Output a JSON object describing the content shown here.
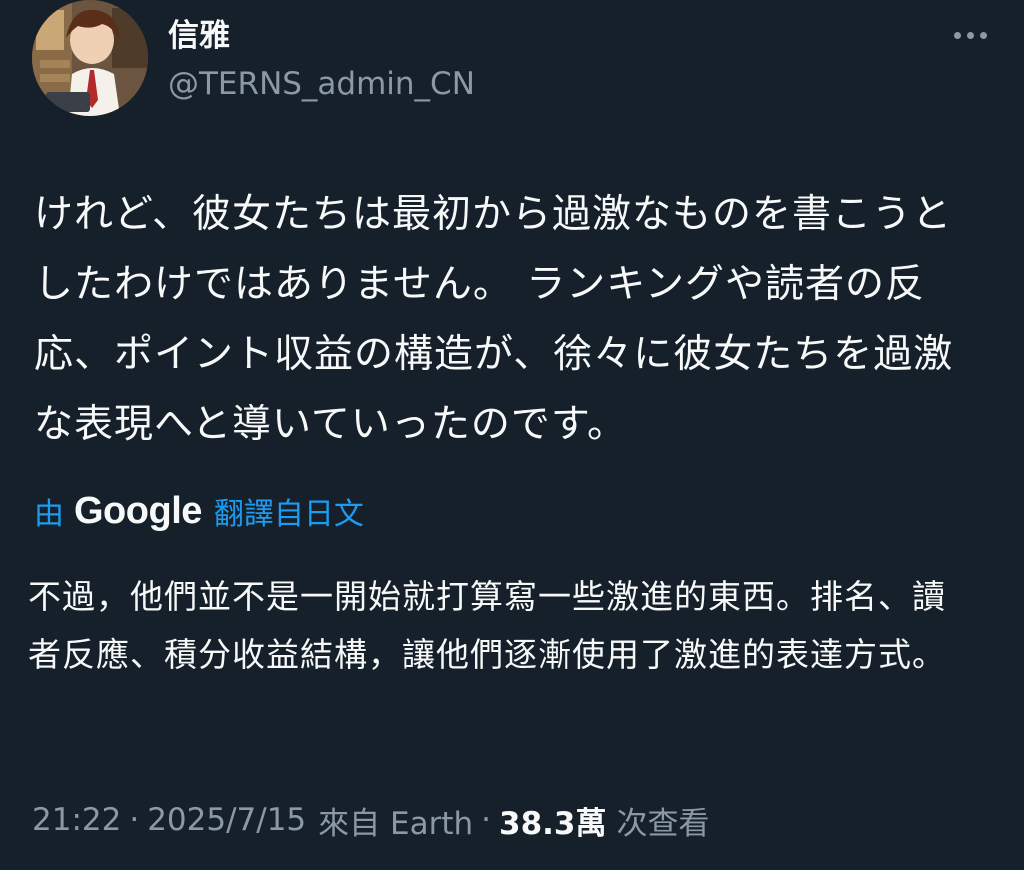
{
  "author": {
    "display_name": "信雅",
    "handle": "@TERNS_admin_CN"
  },
  "tweet": {
    "text": "けれど、彼女たちは最初から過激なものを書こうとしたわけではありません。 ランキングや読者の反応、ポイント収益の構造が、徐々に彼女たちを過激な表現へと導いていったのです。"
  },
  "translation": {
    "prefix": "由",
    "provider": "Google",
    "suffix": "翻譯自日文",
    "text": "不過，他們並不是一開始就打算寫一些激進的東西。排名、讀者反應、積分收益結構，讓他們逐漸使用了激進的表達方式。"
  },
  "meta": {
    "time": "21:22",
    "separator": "·",
    "date": "2025/7/15",
    "source": "來自 Earth",
    "views_count": "38.3萬",
    "views_label": "次查看"
  },
  "icons": {
    "more": "more-horizontal-icon",
    "avatar": "anime-avatar-image"
  },
  "colors": {
    "background": "#15202b",
    "text_primary": "#f7f9f9",
    "text_secondary": "#8b98a5",
    "accent": "#1d9bf0"
  }
}
